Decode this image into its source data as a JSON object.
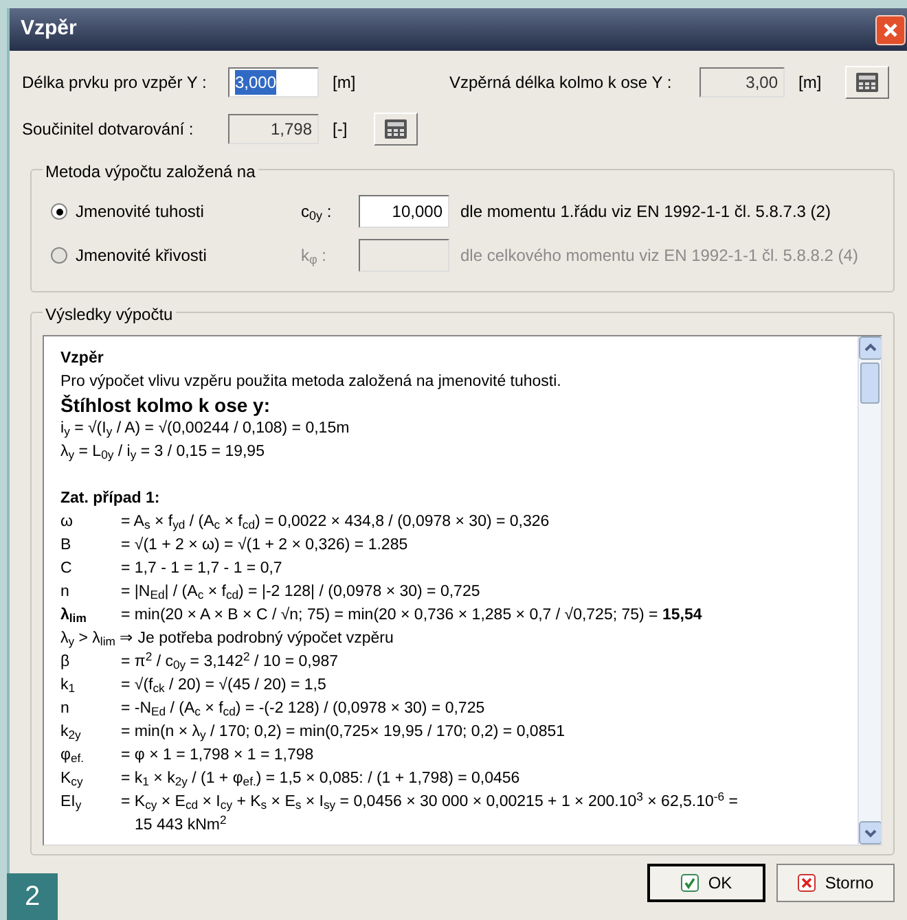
{
  "window": {
    "title": "Vzpěr"
  },
  "length_field": {
    "label": "Délka prvku pro vzpěr Y :",
    "value": "3,000",
    "unit": "[m]",
    "text_selected": true,
    "disabled": false
  },
  "buckling_length_field": {
    "label": "Vzpěrná délka kolmo k ose Y :",
    "value": "3,00",
    "unit": "[m]",
    "disabled": true
  },
  "creep_field": {
    "label": "Součinitel dotvarování :",
    "value": "1,798",
    "unit": "[-]",
    "disabled": true
  },
  "method": {
    "title": "Metoda výpočtu založená na",
    "options": [
      {
        "label": "Jmenovité tuhosti",
        "selected": true,
        "disabled": false,
        "param": "c$_{0y}$ :",
        "value": "10,000",
        "note": "dle momentu 1.řádu viz EN 1992-1-1 čl. 5.8.7.3 (2)"
      },
      {
        "label": "Jmenovité křivosti",
        "selected": false,
        "disabled": true,
        "param": "k$_{φ}$ :",
        "note": "dle celkového momentu viz EN 1992-1-1 čl. 5.8.8.2 (4)"
      }
    ]
  },
  "results": {
    "title": "Výsledky výpočtu",
    "lines": [
      {
        "kind": "title",
        "text": "Vzpěr"
      },
      {
        "kind": "text",
        "text": "Pro výpočet vlivu vzpěru použita metoda založená na jmenovité tuhosti."
      },
      {
        "kind": "heading",
        "text": "Štíhlost kolmo k ose y:"
      },
      {
        "kind": "text",
        "text": "i$_{y}$ = √(I$_{y}$ / A) = √(0,00244 / 0,108) = 0,15m"
      },
      {
        "kind": "text",
        "text": "λ$_{y}$ = L$_{0y}$ / i$_{y}$ = 3 / 0,15 = 19,95"
      },
      {
        "kind": "blank"
      },
      {
        "kind": "title",
        "text": "Zat. případ 1:"
      },
      {
        "kind": "formula",
        "symbol": "ω",
        "expr": "= A$_{s}$ × f$_{yd}$ / (A$_{c}$ × f$_{cd}$) = 0,0022 × 434,8 / (0,0978 × 30) = 0,326"
      },
      {
        "kind": "formula",
        "symbol": "B",
        "expr": "= √(1 + 2 × ω) = √(1 + 2 × 0,326) = 1.285"
      },
      {
        "kind": "formula",
        "symbol": "C",
        "expr": "= 1,7 - 1 = 1,7 - 1 = 0,7"
      },
      {
        "kind": "formula",
        "symbol": "n",
        "expr": "= |N$_{Ed}$| / (A$_{c}$ × f$_{cd}$) = |-2 128| / (0,0978 × 30) = 0,725"
      },
      {
        "kind": "formula",
        "symbol": "**λ$_{lim}$**",
        "expr": "= min(20 × A × B × C / √n; 75) = min(20 × 0,736 × 1,285 × 0,7 / √0,725; 75) = **15,54**"
      },
      {
        "kind": "text",
        "text": "λ$_{y}$ > λ$_{lim}$ ⇒ Je potřeba podrobný výpočet vzpěru"
      },
      {
        "kind": "formula",
        "symbol": "β",
        "expr": "= π$^{2}$ / c$_{0y}$ = 3,142$^{2}$ / 10 = 0,987"
      },
      {
        "kind": "formula",
        "symbol": "k$_{1}$",
        "expr": "= √(f$_{ck}$ / 20) = √(45 / 20) = 1,5"
      },
      {
        "kind": "formula",
        "symbol": "n",
        "expr": "= -N$_{Ed}$ / (A$_{c}$ × f$_{cd}$) = -(-2 128) / (0,0978 × 30) = 0,725"
      },
      {
        "kind": "formula",
        "symbol": "k$_{2y}$",
        "expr": "= min(n × λ$_{y}$ / 170; 0,2) = min(0,725× 19,95 / 170; 0,2) = 0,0851"
      },
      {
        "kind": "formula",
        "symbol": "φ$_{ef.}$",
        "expr": "= φ × 1 = 1,798 × 1 = 1,798"
      },
      {
        "kind": "formula",
        "symbol": "K$_{cy}$",
        "expr": "= k$_{1}$ × k$_{2y}$ / (1 + φ$_{ef.}$) = 1,5 × 0,085: / (1 + 1,798) = 0,0456"
      },
      {
        "kind": "formula",
        "symbol": "EI$_{y}$",
        "expr": "= K$_{cy}$ × E$_{cd}$ × I$_{cy}$ + K$_{s}$ × E$_{s}$ × I$_{sy}$ = 0,0456 × 30 000 × 0,00215 + 1 × 200.10$^{3}$ × 62,5.10$^{-6}$ ="
      },
      {
        "kind": "continuation",
        "text": "15 443 kNm$^{2}$"
      }
    ]
  },
  "buttons": [
    {
      "label": "OK",
      "kind": "ok"
    },
    {
      "label": "Storno",
      "kind": "cancel"
    }
  ],
  "figure_number": "2"
}
